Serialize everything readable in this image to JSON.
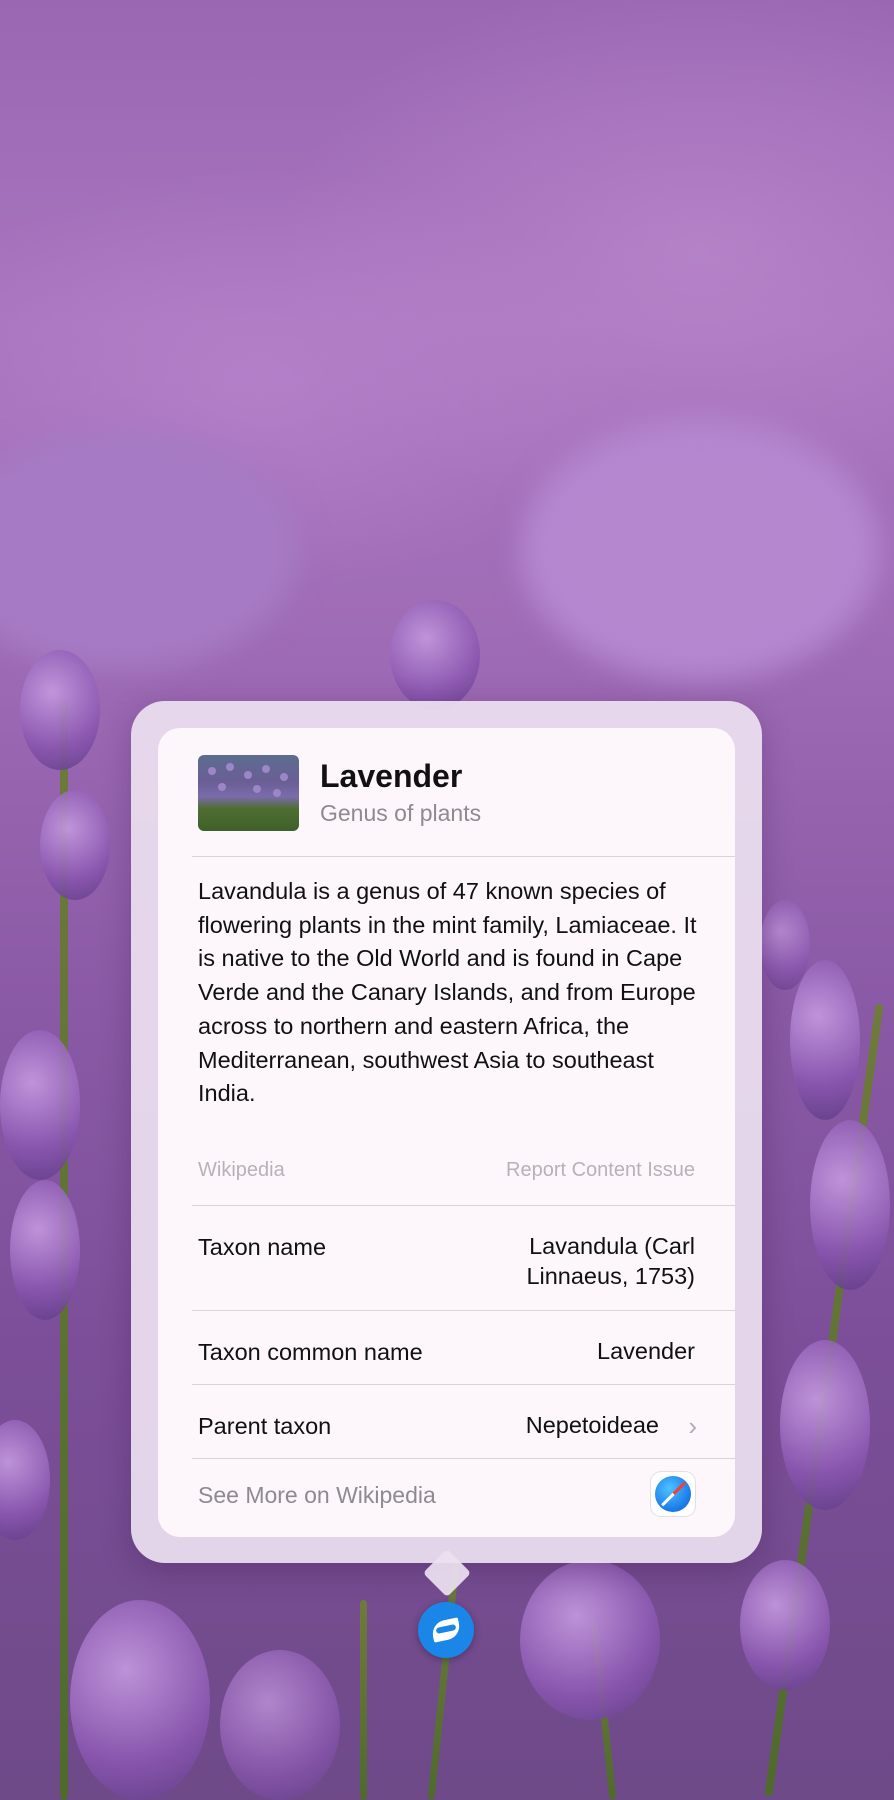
{
  "card": {
    "title": "Lavender",
    "subtitle": "Genus of plants",
    "description": "Lavandula is a genus of 47 known species of flowering plants in the mint family, Lamiaceae. It is native to the Old World and is found in Cape Verde and the Canary Islands, and from Europe across to northern and eastern Africa, the Mediterranean, southwest Asia to southeast India.",
    "source": "Wikipedia",
    "report_label": "Report Content Issue",
    "rows": [
      {
        "key": "Taxon name",
        "value_line1": "Lavandula (Carl",
        "value_line2": "Linnaeus, 1753)"
      },
      {
        "key": "Taxon common name",
        "value": "Lavender"
      },
      {
        "key": "Parent taxon",
        "value": "Nepetoideae"
      }
    ],
    "see_more": "See More on Wikipedia"
  },
  "icons": {
    "thumbnail": "lavender-thumbnail",
    "chevron": "chevron-right-icon",
    "browser": "safari-icon",
    "visual_lookup": "visual-lookup-leaf-icon"
  },
  "colors": {
    "card_bg": "#fdf7fb",
    "lookup_button": "#1a86e8",
    "secondary_text": "#8e8a90"
  }
}
